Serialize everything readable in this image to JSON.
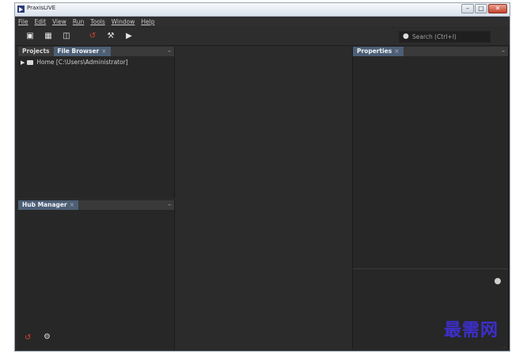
{
  "window": {
    "title": "PraxisLIVE",
    "controls": {
      "minimize": "–",
      "maximize": "□",
      "close": "✕"
    }
  },
  "menu": [
    "File",
    "Edit",
    "View",
    "Run",
    "Tools",
    "Window",
    "Help"
  ],
  "toolbar": {
    "buttons": [
      "new-project-icon",
      "open-project-icon",
      "new-file-icon",
      "undo-icon",
      "build-icon",
      "run-icon"
    ],
    "search_placeholder": "Search (Ctrl+I)"
  },
  "left_top_panel": {
    "tabs": [
      {
        "label": "Projects",
        "active": false
      },
      {
        "label": "File Browser",
        "active": true
      }
    ],
    "close_glyph": "×",
    "minimize_glyph": "–",
    "tree": [
      {
        "label": "Home [C:\\Users\\Administrator]"
      }
    ]
  },
  "left_bottom_panel": {
    "tabs": [
      {
        "label": "Hub Manager",
        "active": true
      }
    ],
    "close_glyph": "×",
    "minimize_glyph": "–",
    "buttons": [
      "restart-icon",
      "settings-icon"
    ]
  },
  "right_panel": {
    "tabs": [
      {
        "label": "Properties",
        "active": true
      }
    ],
    "close_glyph": "×",
    "minimize_glyph": "–"
  },
  "watermark": "最需网",
  "colors": {
    "accent_tab": "#4d5f76",
    "icon_red": "#d9442c",
    "background": "#2a2a2a"
  }
}
